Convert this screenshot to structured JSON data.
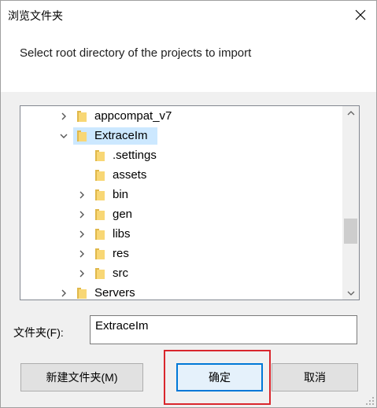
{
  "window": {
    "title": "浏览文件夹",
    "close_icon": "close-icon"
  },
  "prompt": "Select root directory of the projects to import",
  "tree": {
    "rows": [
      {
        "label": "appcompat_v7",
        "expander": "collapsed",
        "selected": false,
        "indent": 0
      },
      {
        "label": "ExtraceIm",
        "expander": "expanded",
        "selected": true,
        "indent": 0
      },
      {
        "label": ".settings",
        "expander": "none",
        "selected": false,
        "indent": 1
      },
      {
        "label": "assets",
        "expander": "none",
        "selected": false,
        "indent": 1
      },
      {
        "label": "bin",
        "expander": "collapsed",
        "selected": false,
        "indent": 1
      },
      {
        "label": "gen",
        "expander": "collapsed",
        "selected": false,
        "indent": 1
      },
      {
        "label": "libs",
        "expander": "collapsed",
        "selected": false,
        "indent": 1
      },
      {
        "label": "res",
        "expander": "collapsed",
        "selected": false,
        "indent": 1
      },
      {
        "label": "src",
        "expander": "collapsed",
        "selected": false,
        "indent": 1
      },
      {
        "label": "Servers",
        "expander": "collapsed",
        "selected": false,
        "indent": 0
      }
    ],
    "scroll_position": 0.7
  },
  "folder_field": {
    "label": "文件夹(F):",
    "value": "ExtraceIm"
  },
  "buttons": {
    "new_folder": "新建文件夹(M)",
    "ok": "确定",
    "cancel": "取消"
  },
  "colors": {
    "selection": "#cce8ff",
    "default_button_border": "#0078d7",
    "annotation_box": "#d9262c",
    "folder_yellow": "#f8d775"
  }
}
